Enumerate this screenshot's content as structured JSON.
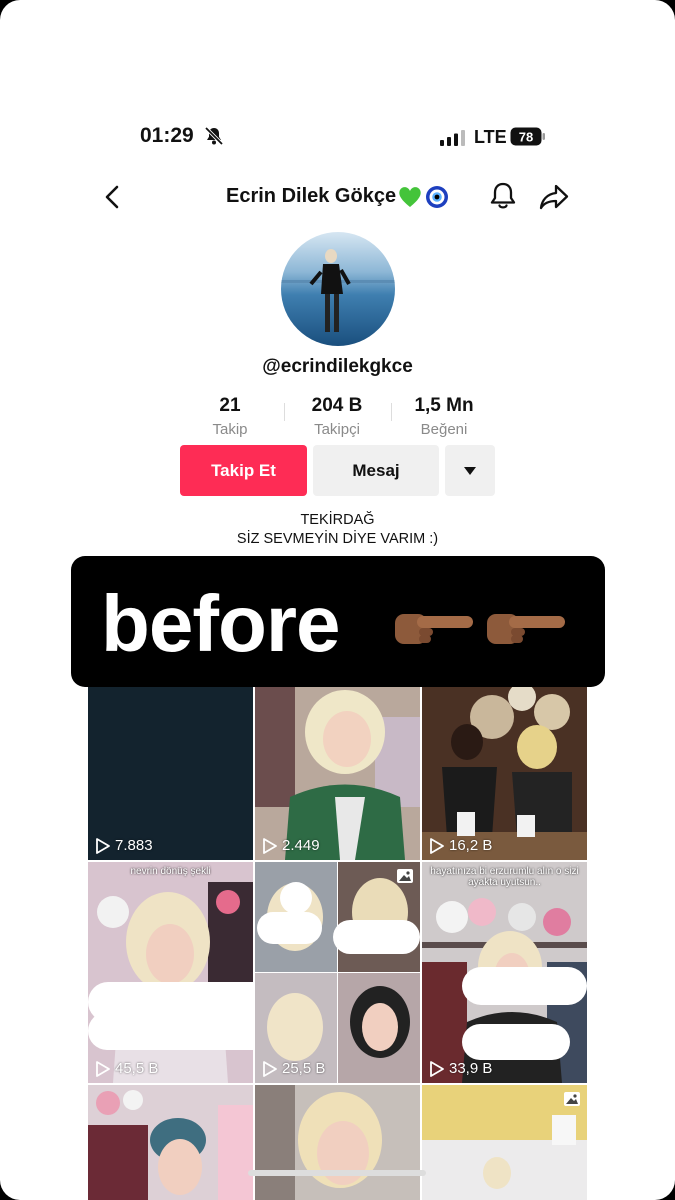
{
  "status": {
    "time": "01:29",
    "network": "LTE",
    "battery": "78"
  },
  "header": {
    "title": "Ecrin Dilek Gökçe"
  },
  "profile": {
    "handle": "@ecrindilekgkce",
    "stats": [
      {
        "value": "21",
        "label": "Takip"
      },
      {
        "value": "204 B",
        "label": "Takipçi"
      },
      {
        "value": "1,5 Mn",
        "label": "Beğeni"
      }
    ],
    "buttons": {
      "follow": "Takip Et",
      "message": "Mesaj"
    },
    "bio": [
      "TEKİRDAĞ",
      "SİZ SEVMEYİN DİYE VARIM :)"
    ]
  },
  "banner": {
    "text": "before"
  },
  "videos": [
    {
      "views": "7.883"
    },
    {
      "views": "2.449"
    },
    {
      "views": "16,2 B"
    },
    {
      "views": "45,5 B",
      "caption": "nevrin dönüş şekli"
    },
    {
      "views": "25,5 B"
    },
    {
      "views": "33,9 B",
      "caption": "hayatınıza bi erzurumlu alın o sizi ayakta uyutsun.."
    }
  ]
}
